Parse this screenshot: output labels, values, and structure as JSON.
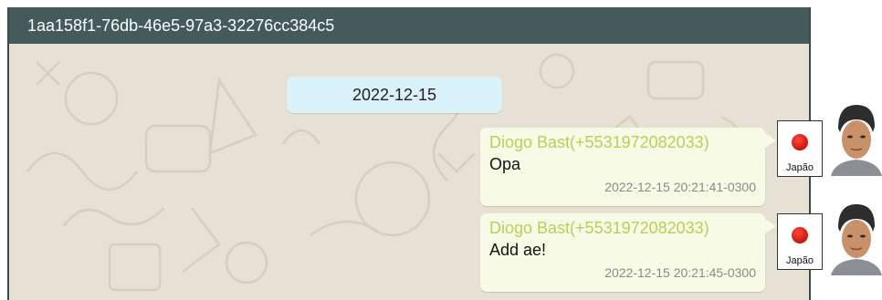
{
  "window": {
    "title": "1aa158f1-76db-46e5-97a3-32276cc384c5"
  },
  "date_separator": "2022-12-15",
  "messages": [
    {
      "sender": "Diogo Bast(+5531972082033)",
      "text": "Opa",
      "timestamp": "2022-12-15 20:21:41-0300",
      "country_flag": "Japão",
      "flag_icon": "japan-flag-icon",
      "avatar_icon": "sender-avatar"
    },
    {
      "sender": "Diogo Bast(+5531972082033)",
      "text": "Add ae!",
      "timestamp": "2022-12-15 20:21:45-0300",
      "country_flag": "Japão",
      "flag_icon": "japan-flag-icon",
      "avatar_icon": "sender-avatar"
    }
  ],
  "colors": {
    "titlebar_bg": "#455a5a",
    "chat_bg": "#e7e0d5",
    "date_chip_bg": "#dcf2fb",
    "bubble_bg": "#f7fbe6",
    "sender_name": "#b7cf58",
    "timestamp": "#8a8a8a",
    "flag_red": "#d1160b"
  }
}
